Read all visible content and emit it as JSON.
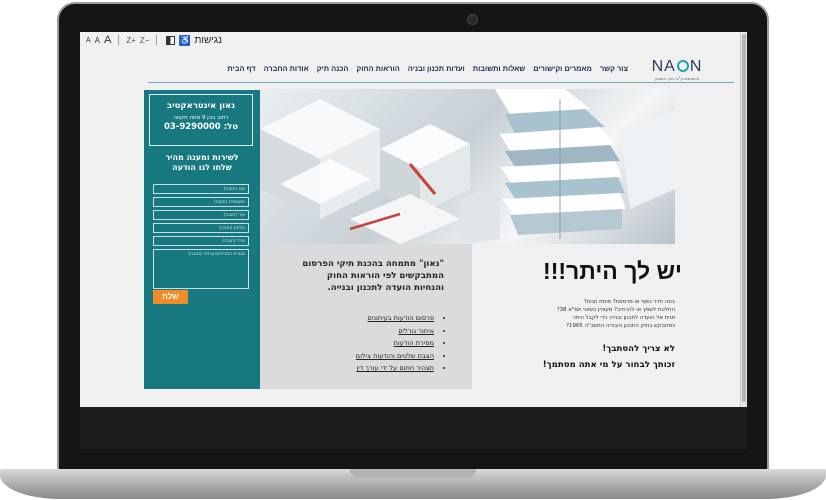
{
  "accessibility": {
    "font_small": "A",
    "font_medium": "A",
    "font_large": "A",
    "zoom_in": "Z+",
    "zoom_out": "Z−",
    "wheelchair": "♿",
    "label": "נגישות"
  },
  "logo": {
    "text_before": "NA",
    "text_after": "N",
    "subtitle": "פרסומים ע\"פ חוקי התכנון"
  },
  "nav": {
    "items": [
      "דף הבית",
      "אודות החברה",
      "הכנה תיק",
      "הוראות החוק",
      "ועדות תכנון ובניה",
      "שאלות ותשובות",
      "מאמרים וקישורים",
      "צור קשר"
    ]
  },
  "company": {
    "name": "נאון אינטראקטיב",
    "address": "רחוב בגין 9 פתח תקווה",
    "phone": "טל: 03-9290000"
  },
  "contact": {
    "title_line1": "לשירות ומענה מהיר",
    "title_line2": "שלחו לנו הודעה",
    "fields": [
      "שם (חובה)",
      "חשבונית (חובה)",
      "עיר (חובה)",
      "טלפון (חובה)",
      "מייל (חובה)"
    ],
    "message_placeholder": "מטרת הפנייה/הערות: (חובה)",
    "send_label": "שלח"
  },
  "services": {
    "intro": "\"נאון\" מתמחה בהכנת תיקי הפרסום המתבקשים לפי הוראות החוק והנחיות הועדה לתכנון ובנייה.",
    "items": [
      "פרסום הודעות בעיתונים",
      "איתור גורלים",
      "מסירת הודעות",
      "הצבת שלטים והודעות צילום",
      "תצהיר חתום על ידי עורך דין"
    ]
  },
  "headline": "יש לך היתר!!!",
  "questions": [
    "בונה חדר נוסף או מרפסת? פותח חנות?",
    "החלטת לשפץ או להרחיב? מעוניין בשינוי תמ\"א 38?",
    "פנית אל הועדה לתכנון ובנייה כדי לקבל היתר",
    "כמתבקש בחוק התכנון והבנייה התשכ\"ה 1965?"
  ],
  "tagline": {
    "line1": "לא צריך להסתבך!",
    "line2": "זכותך לבחור על מי אתה מסתמך!"
  },
  "colors": {
    "teal": "#17787f",
    "orange": "#f28c28",
    "navy": "#1f2d4a"
  }
}
